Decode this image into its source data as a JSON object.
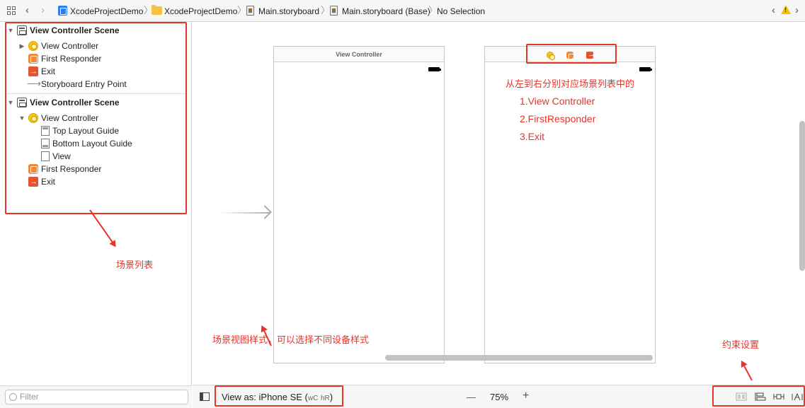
{
  "jumpbar": {
    "project": "XcodeProjectDemo",
    "group": "XcodeProjectDemo",
    "file": "Main.storyboard",
    "localized_file": "Main.storyboard (Base)",
    "selection": "No Selection"
  },
  "outline": {
    "scene1": {
      "title": "View Controller Scene",
      "items": [
        "View Controller",
        "First Responder",
        "Exit",
        "Storyboard Entry Point"
      ]
    },
    "scene2": {
      "title": "View Controller Scene",
      "view_controller": "View Controller",
      "children": [
        "Top Layout Guide",
        "Bottom Layout Guide",
        "View"
      ],
      "items": [
        "First Responder",
        "Exit"
      ]
    },
    "filter_placeholder": "Filter"
  },
  "canvas": {
    "scene1_title": "View Controller"
  },
  "bottombar": {
    "view_as_label": "View as: iPhone SE (",
    "size_class_w": "wC",
    "size_class_h": "hR",
    "view_as_close": ")",
    "zoom_out": "—",
    "zoom": "75%",
    "zoom_in": "+"
  },
  "annotations": {
    "scene_list": "场景列表",
    "dock_title": "从左到右分别对应场景列表中的",
    "dock_items": [
      "1.View Controller",
      "2.FirstResponder",
      "3.Exit"
    ],
    "view_as_note": "场景视图样式，可以选择不同设备样式",
    "constraints_note": "约束设置",
    "color": "#e8342a"
  }
}
